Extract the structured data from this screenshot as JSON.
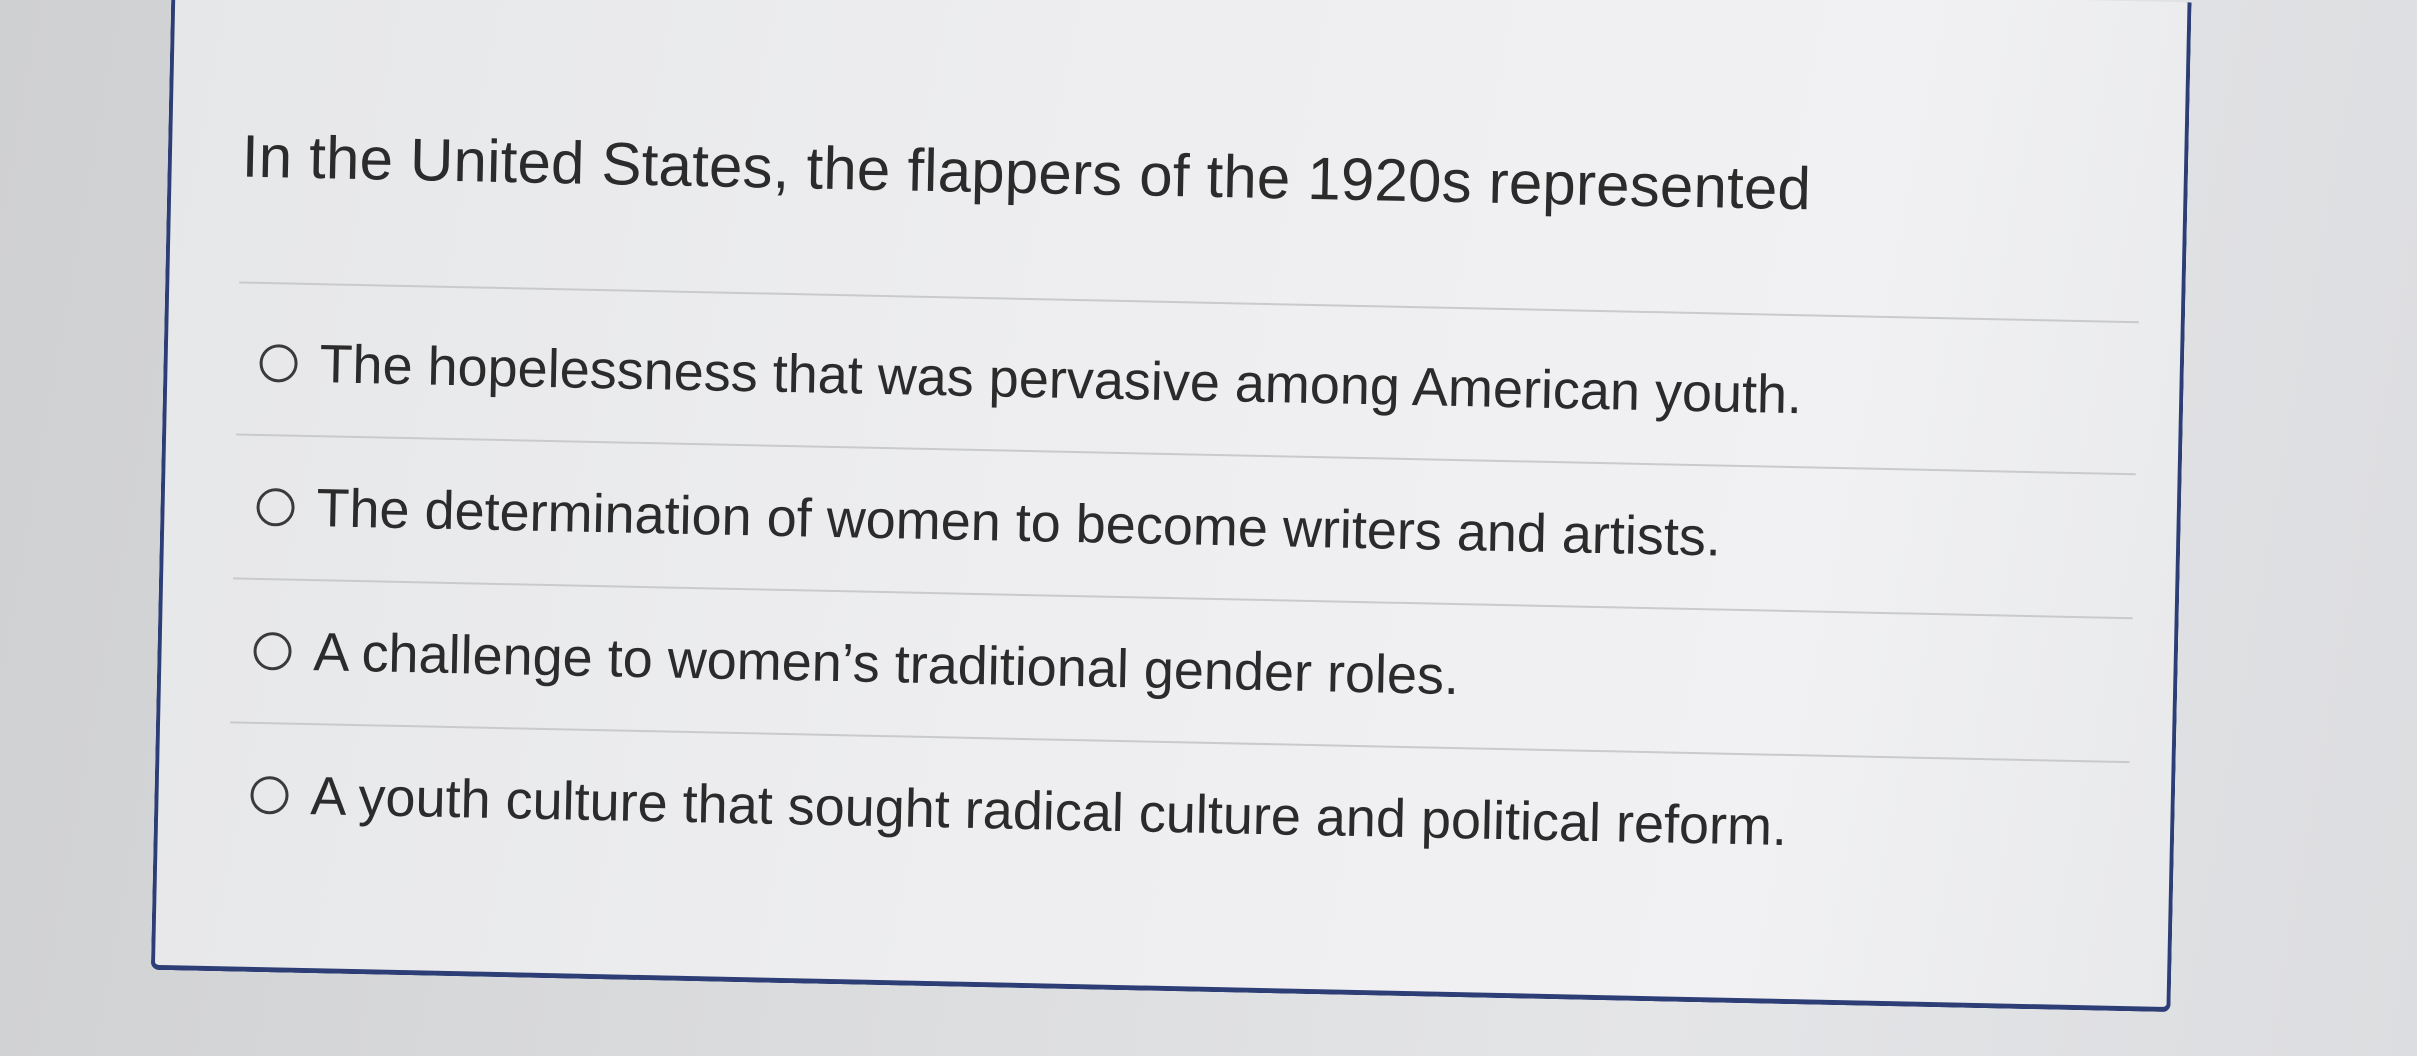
{
  "question": {
    "text": "In the United States, the flappers of the 1920s represented"
  },
  "options": [
    {
      "label": "The hopelessness that was pervasive among American youth."
    },
    {
      "label": "The determination of women to become writers and artists."
    },
    {
      "label": "A challenge to women’s traditional gender roles."
    },
    {
      "label": "A youth culture that sought radical culture and political reform."
    }
  ],
  "colors": {
    "card_border": "#2c3e75",
    "text": "#2b2b2b",
    "divider": "#c9cacc"
  }
}
